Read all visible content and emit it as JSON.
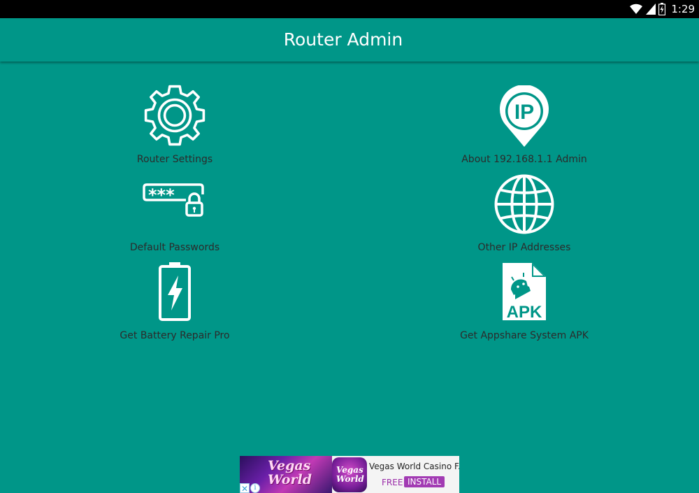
{
  "status_bar": {
    "time": "1:29",
    "icons": [
      "wifi-icon",
      "signal-icon",
      "battery-charging-icon"
    ]
  },
  "app_bar": {
    "title": "Router Admin"
  },
  "menu": {
    "router_settings": {
      "label": "Router Settings",
      "icon": "gear-icon"
    },
    "about_admin": {
      "label": "About 192.168.1.1 Admin",
      "icon": "ip-location-pin-icon"
    },
    "default_passwords": {
      "label": "Default Passwords",
      "icon": "password-lock-icon"
    },
    "other_ip": {
      "label": "Other IP Addresses",
      "icon": "globe-icon"
    },
    "battery_repair": {
      "label": "Get Battery Repair Pro",
      "icon": "battery-bolt-icon"
    },
    "appshare": {
      "label": "Get Appshare System APK",
      "icon": "apk-file-icon"
    }
  },
  "icon_text": {
    "ip": "IP",
    "password_mask": "***",
    "apk": "APK"
  },
  "ad": {
    "title": "Vegas World Casino F...",
    "image_text": "Vegas World",
    "icon_text": "Vegas World",
    "free_label": "FREE",
    "install_label": "INSTALL",
    "close_glyph": "✕",
    "info_glyph": "i"
  },
  "colors": {
    "primary": "#009688",
    "status_bar": "#000000",
    "icon": "#ffffff",
    "label": "#2b2b2b",
    "ad_accent": "#a23bb3"
  }
}
